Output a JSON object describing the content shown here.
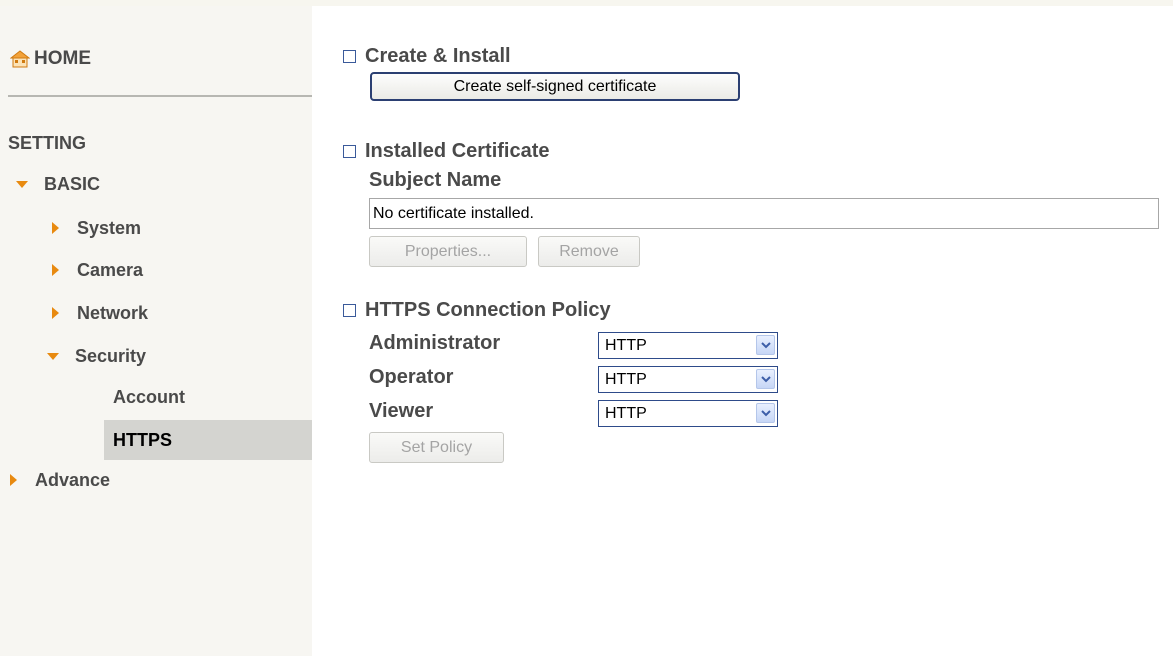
{
  "sidebar": {
    "home_label": "HOME",
    "setting_label": "SETTING",
    "basic_label": "BASIC",
    "system_label": "System",
    "camera_label": "Camera",
    "network_label": "Network",
    "security_label": "Security",
    "account_label": "Account",
    "https_label": "HTTPS",
    "advance_label": "Advance"
  },
  "create_install": {
    "title": "Create & Install",
    "button_label": "Create self-signed certificate"
  },
  "installed_certificate": {
    "title": "Installed Certificate",
    "subject_label": "Subject Name",
    "subject_value": "No certificate installed.",
    "properties_label": "Properties...",
    "remove_label": "Remove"
  },
  "policy": {
    "title": "HTTPS Connection Policy",
    "administrator_label": "Administrator",
    "administrator_value": "HTTP",
    "operator_label": "Operator",
    "operator_value": "HTTP",
    "viewer_label": "Viewer",
    "viewer_value": "HTTP",
    "set_policy_label": "Set Policy"
  },
  "colors": {
    "accent_arrow": "#e88a10",
    "selected_bg": "#d4d4d0",
    "sidebar_bg": "#f7f6f2",
    "text": "#4a4a4a"
  },
  "icons": {
    "home": "home-icon",
    "expand": "triangle-right-icon",
    "collapse": "triangle-down-icon",
    "section": "square-bullet-icon",
    "dropdown": "chevron-down-icon"
  }
}
